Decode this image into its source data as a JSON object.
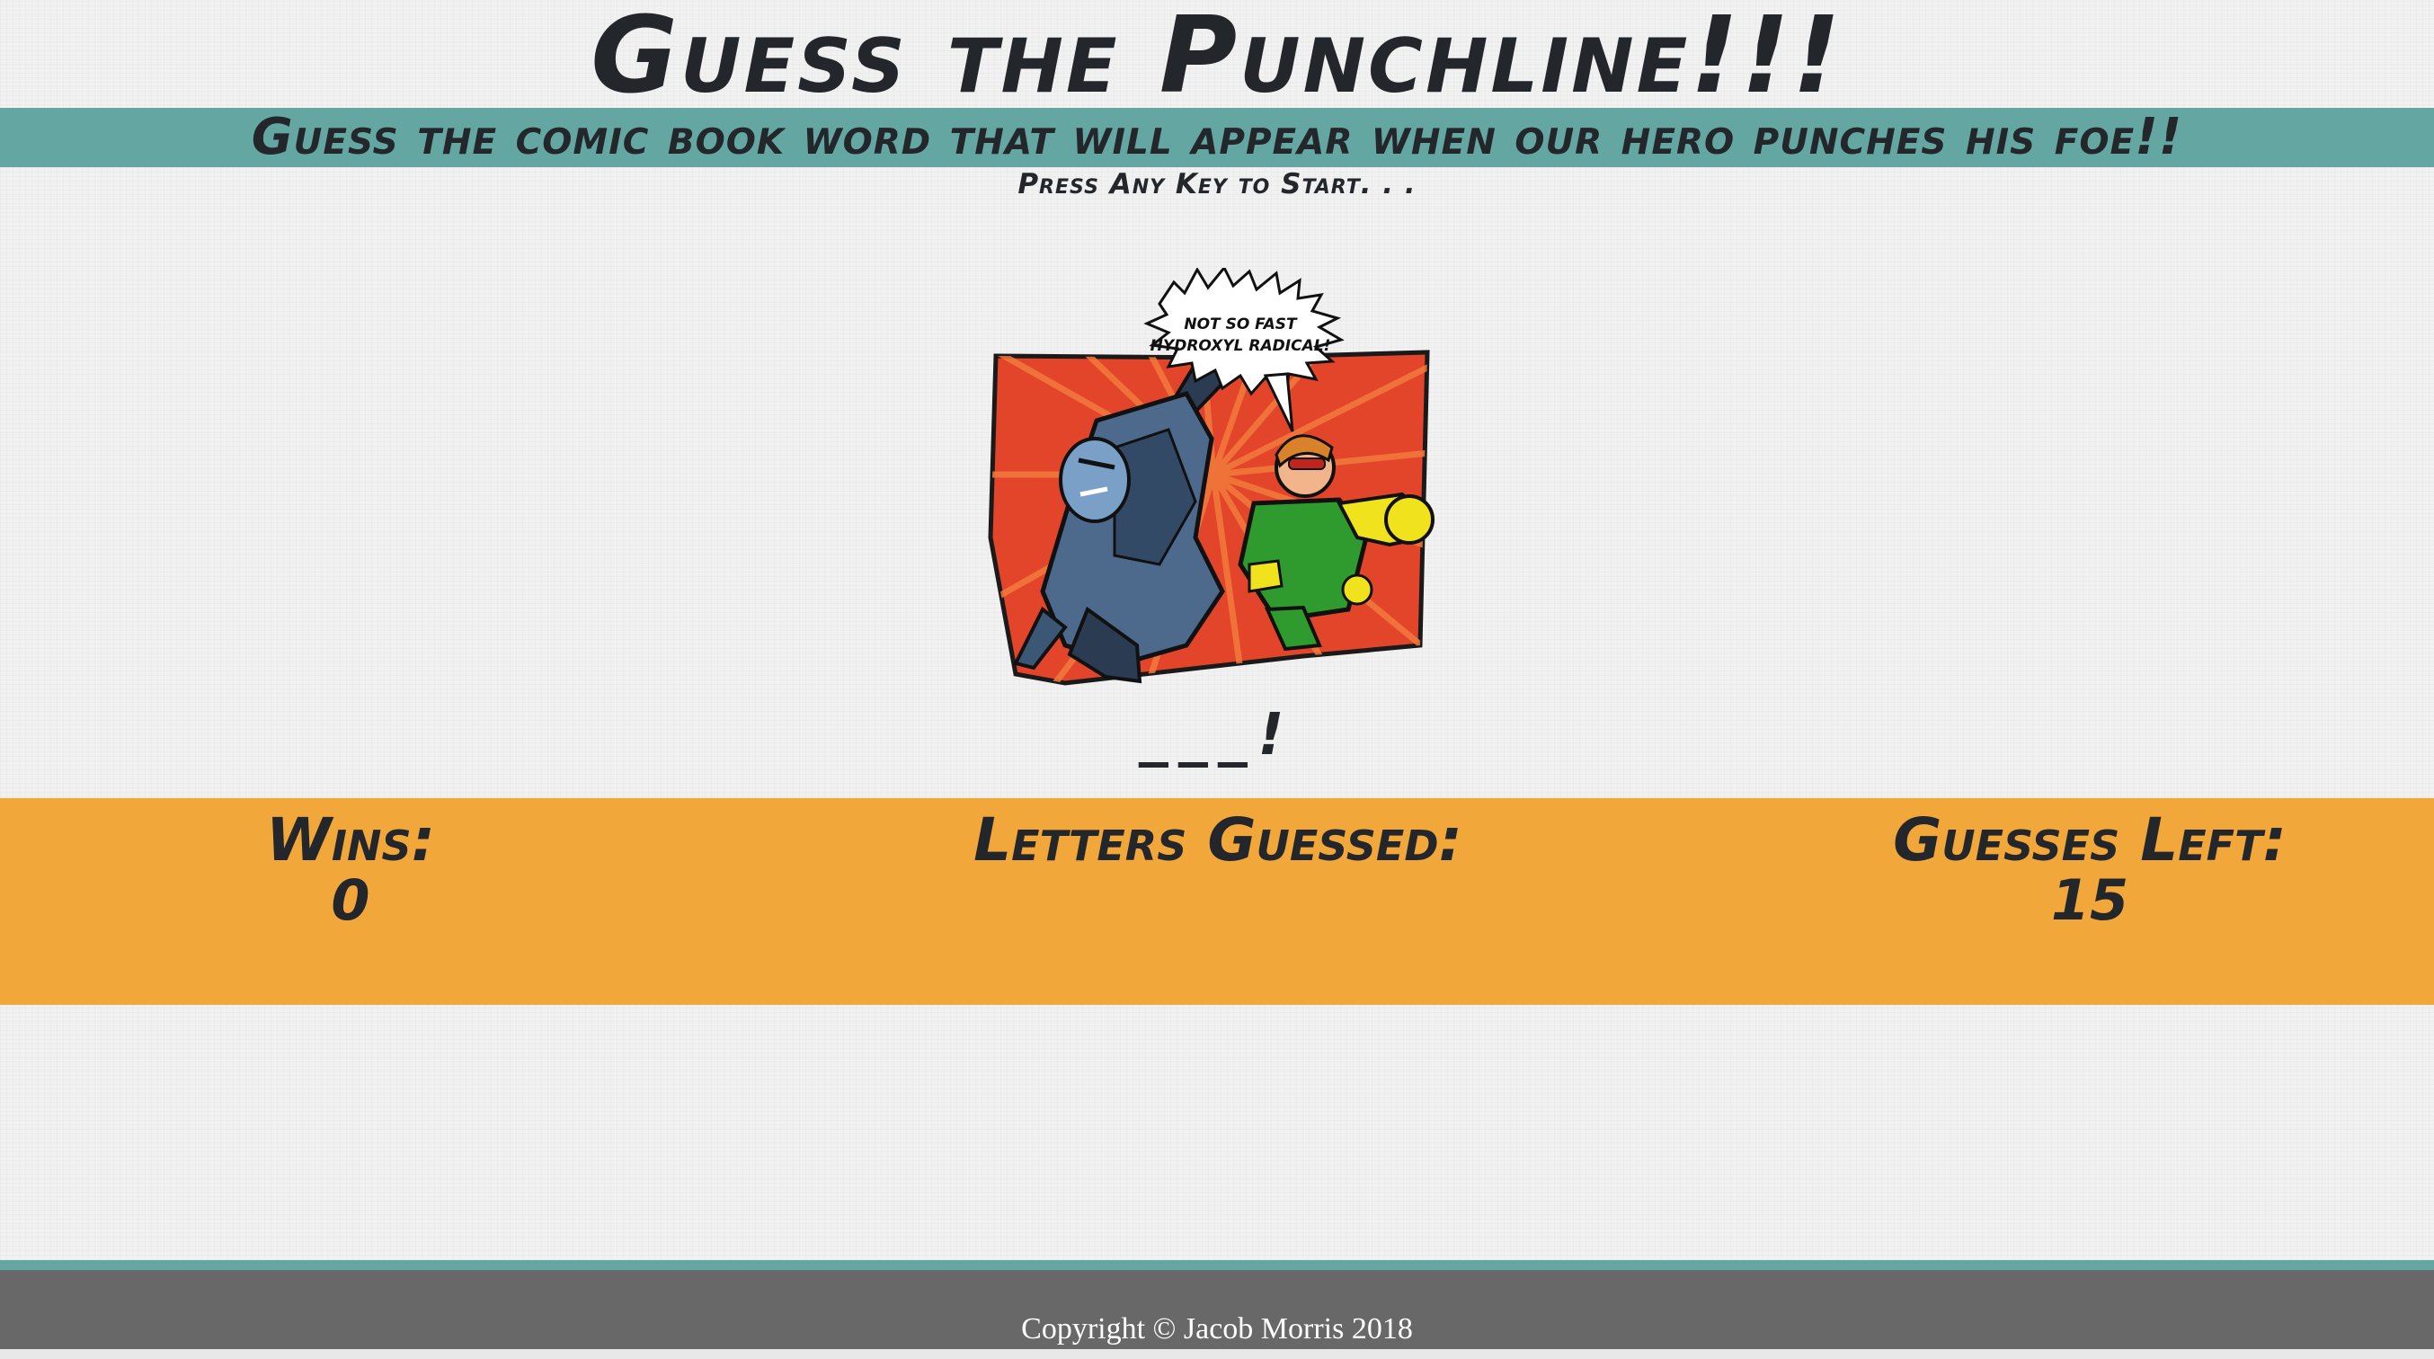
{
  "header": {
    "title": "Guess the Punchline!!!",
    "subtitle": "Guess the comic book word that will appear when our hero punches his foe!!",
    "prompt": "Press Any Key to Start. . ."
  },
  "scene": {
    "speech_line1": "NOT SO FAST",
    "speech_line2": "HYDROXYL RADICAL!"
  },
  "word": {
    "display": "___!"
  },
  "scoreboard": {
    "wins_label": "Wins:",
    "wins_value": "0",
    "letters_label": "Letters Guessed:",
    "letters_value": "",
    "guesses_label": "Guesses Left:",
    "guesses_value": "15"
  },
  "footer": {
    "copyright": "Copyright © Jacob Morris 2018"
  },
  "colors": {
    "teal": "#64a6a1",
    "orange": "#f2a73b",
    "footer_gray": "#686868",
    "panel_red": "#e2452a",
    "hero_green": "#2f9a2e",
    "hero_yellow": "#f1e21e",
    "villain_blue": "#4d6a8c"
  }
}
